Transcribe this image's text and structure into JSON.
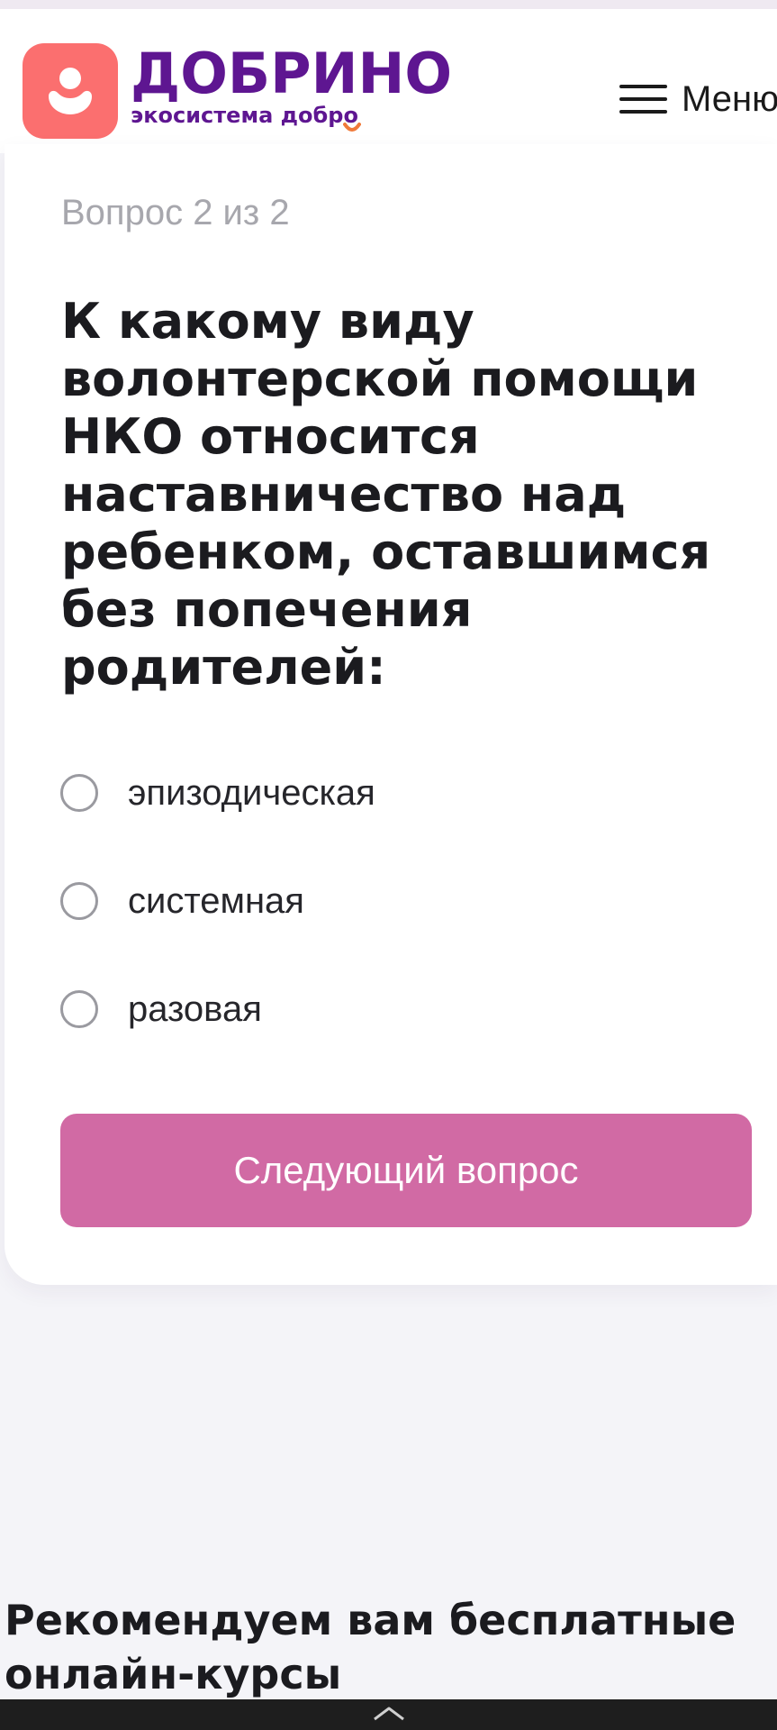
{
  "header": {
    "logo_title": "ДОБРИНО",
    "logo_subtitle": "экосистема добро",
    "menu_label": "Меню"
  },
  "quiz": {
    "counter": "Вопрос 2 из 2",
    "question": "К какому виду волонтерской помощи НКО относится наставничество над ребенком, оставшимся без попечения родителей:",
    "options": [
      {
        "label": "эпизодическая",
        "selected": false
      },
      {
        "label": "системная",
        "selected": false
      },
      {
        "label": "разовая",
        "selected": false
      }
    ],
    "next_label": "Следующий вопрос"
  },
  "recommend": {
    "title": "Рекомендуем вам бесплатные онлайн-курсы"
  },
  "colors": {
    "brand_purple": "#5e1691",
    "logo_badge": "#fb6f6f",
    "button": "#d16aa4",
    "page_bg": "#f4f4f8"
  },
  "icons": {
    "logo": "person-icon",
    "menu": "hamburger-icon",
    "radio": "radio-unchecked-icon",
    "system_nav": "home-handle-icon"
  }
}
